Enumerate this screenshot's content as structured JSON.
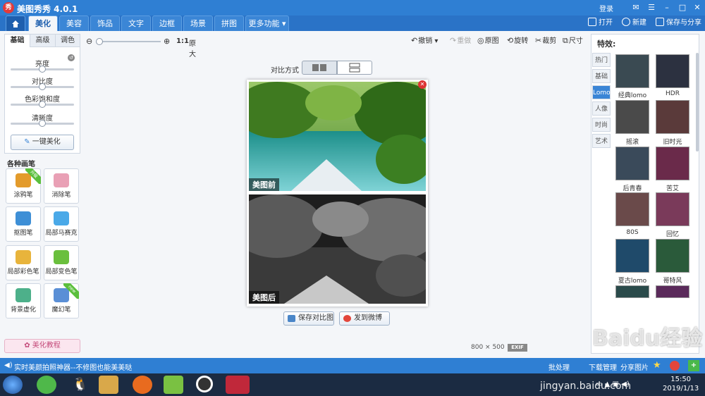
{
  "app": {
    "title": "美图秀秀 4.0.1",
    "logo_char": "秀",
    "login": "登录"
  },
  "tabs": [
    {
      "label": "美化"
    },
    {
      "label": "美容"
    },
    {
      "label": "饰品"
    },
    {
      "label": "文字"
    },
    {
      "label": "边框"
    },
    {
      "label": "场景"
    },
    {
      "label": "拼图"
    },
    {
      "label": "更多功能 ▾"
    }
  ],
  "top_right": {
    "open": "打开",
    "new": "新建",
    "save_share": "保存与分享"
  },
  "left_panel": {
    "subtabs": [
      "基础",
      "高级",
      "调色"
    ],
    "sliders": [
      {
        "label": "亮度",
        "value": 0.5
      },
      {
        "label": "对比度",
        "value": 0.5
      },
      {
        "label": "色彩饱和度",
        "value": 0.5
      },
      {
        "label": "清晰度",
        "value": 0.5
      }
    ],
    "one_key": "一键美化",
    "brushes_title": "各种画笔",
    "brushes": [
      {
        "label": "涂鸦笔",
        "color": "#e39b2b",
        "badge": "升级"
      },
      {
        "label": "消除笔",
        "color": "#e9a0b5",
        "badge": ""
      },
      {
        "label": "抠图笔",
        "color": "#3e8fd6",
        "badge": ""
      },
      {
        "label": "局部马赛克",
        "color": "#4aa9e8",
        "badge": ""
      },
      {
        "label": "局部彩色笔",
        "color": "#e8b43c",
        "badge": ""
      },
      {
        "label": "局部变色笔",
        "color": "#6abf3d",
        "badge": ""
      },
      {
        "label": "背景虚化",
        "color": "#4db08a",
        "badge": ""
      },
      {
        "label": "魔幻笔",
        "color": "#5a8fd6",
        "badge": "new"
      }
    ],
    "tutorial": "美化教程"
  },
  "zoom": {
    "ratio": "1:1",
    "original": "原大"
  },
  "edit_tools": {
    "undo": "撤销",
    "redo": "重做",
    "original": "原图",
    "rotate": "旋转",
    "crop": "裁剪",
    "size": "尺寸"
  },
  "compare": {
    "label": "对比方式"
  },
  "photos": {
    "before": "美图前",
    "after": "美图后"
  },
  "actions": {
    "save_compare": "保存对比图",
    "send_weibo": "发到微博"
  },
  "image_info": {
    "size": "800 × 500",
    "exif": "EXIF"
  },
  "effects": {
    "title": "特效:",
    "categories": [
      "热门",
      "基础",
      "Lomo",
      "人像",
      "时尚",
      "艺术"
    ],
    "active_category": "Lomo",
    "items": [
      {
        "label": "经典lomo",
        "tint": "#3a4a52"
      },
      {
        "label": "HDR",
        "tint": "#2c3140"
      },
      {
        "label": "摇滚",
        "tint": "#4a4a4a"
      },
      {
        "label": "旧时光",
        "tint": "#5a3a3a"
      },
      {
        "label": "后青春",
        "tint": "#3a4a5a"
      },
      {
        "label": "苦艾",
        "tint": "#6a2a4a"
      },
      {
        "label": "80S",
        "tint": "#6a4a4a"
      },
      {
        "label": "回忆",
        "tint": "#7a3a5a"
      },
      {
        "label": "夏古lomo",
        "tint": "#1f4a6a"
      },
      {
        "label": "哥特风",
        "tint": "#2a5a3a"
      }
    ]
  },
  "statusbar": {
    "tip": "实时美颜拍照神器--不修图也能美美哒",
    "batch": "批处理",
    "download": "下载管理",
    "share": "分享图片"
  },
  "taskbar": {
    "time": "15:50",
    "date": "2019/1/13"
  },
  "watermark": {
    "text": "Baidu经验",
    "url": "jingyan.baidu.com"
  }
}
